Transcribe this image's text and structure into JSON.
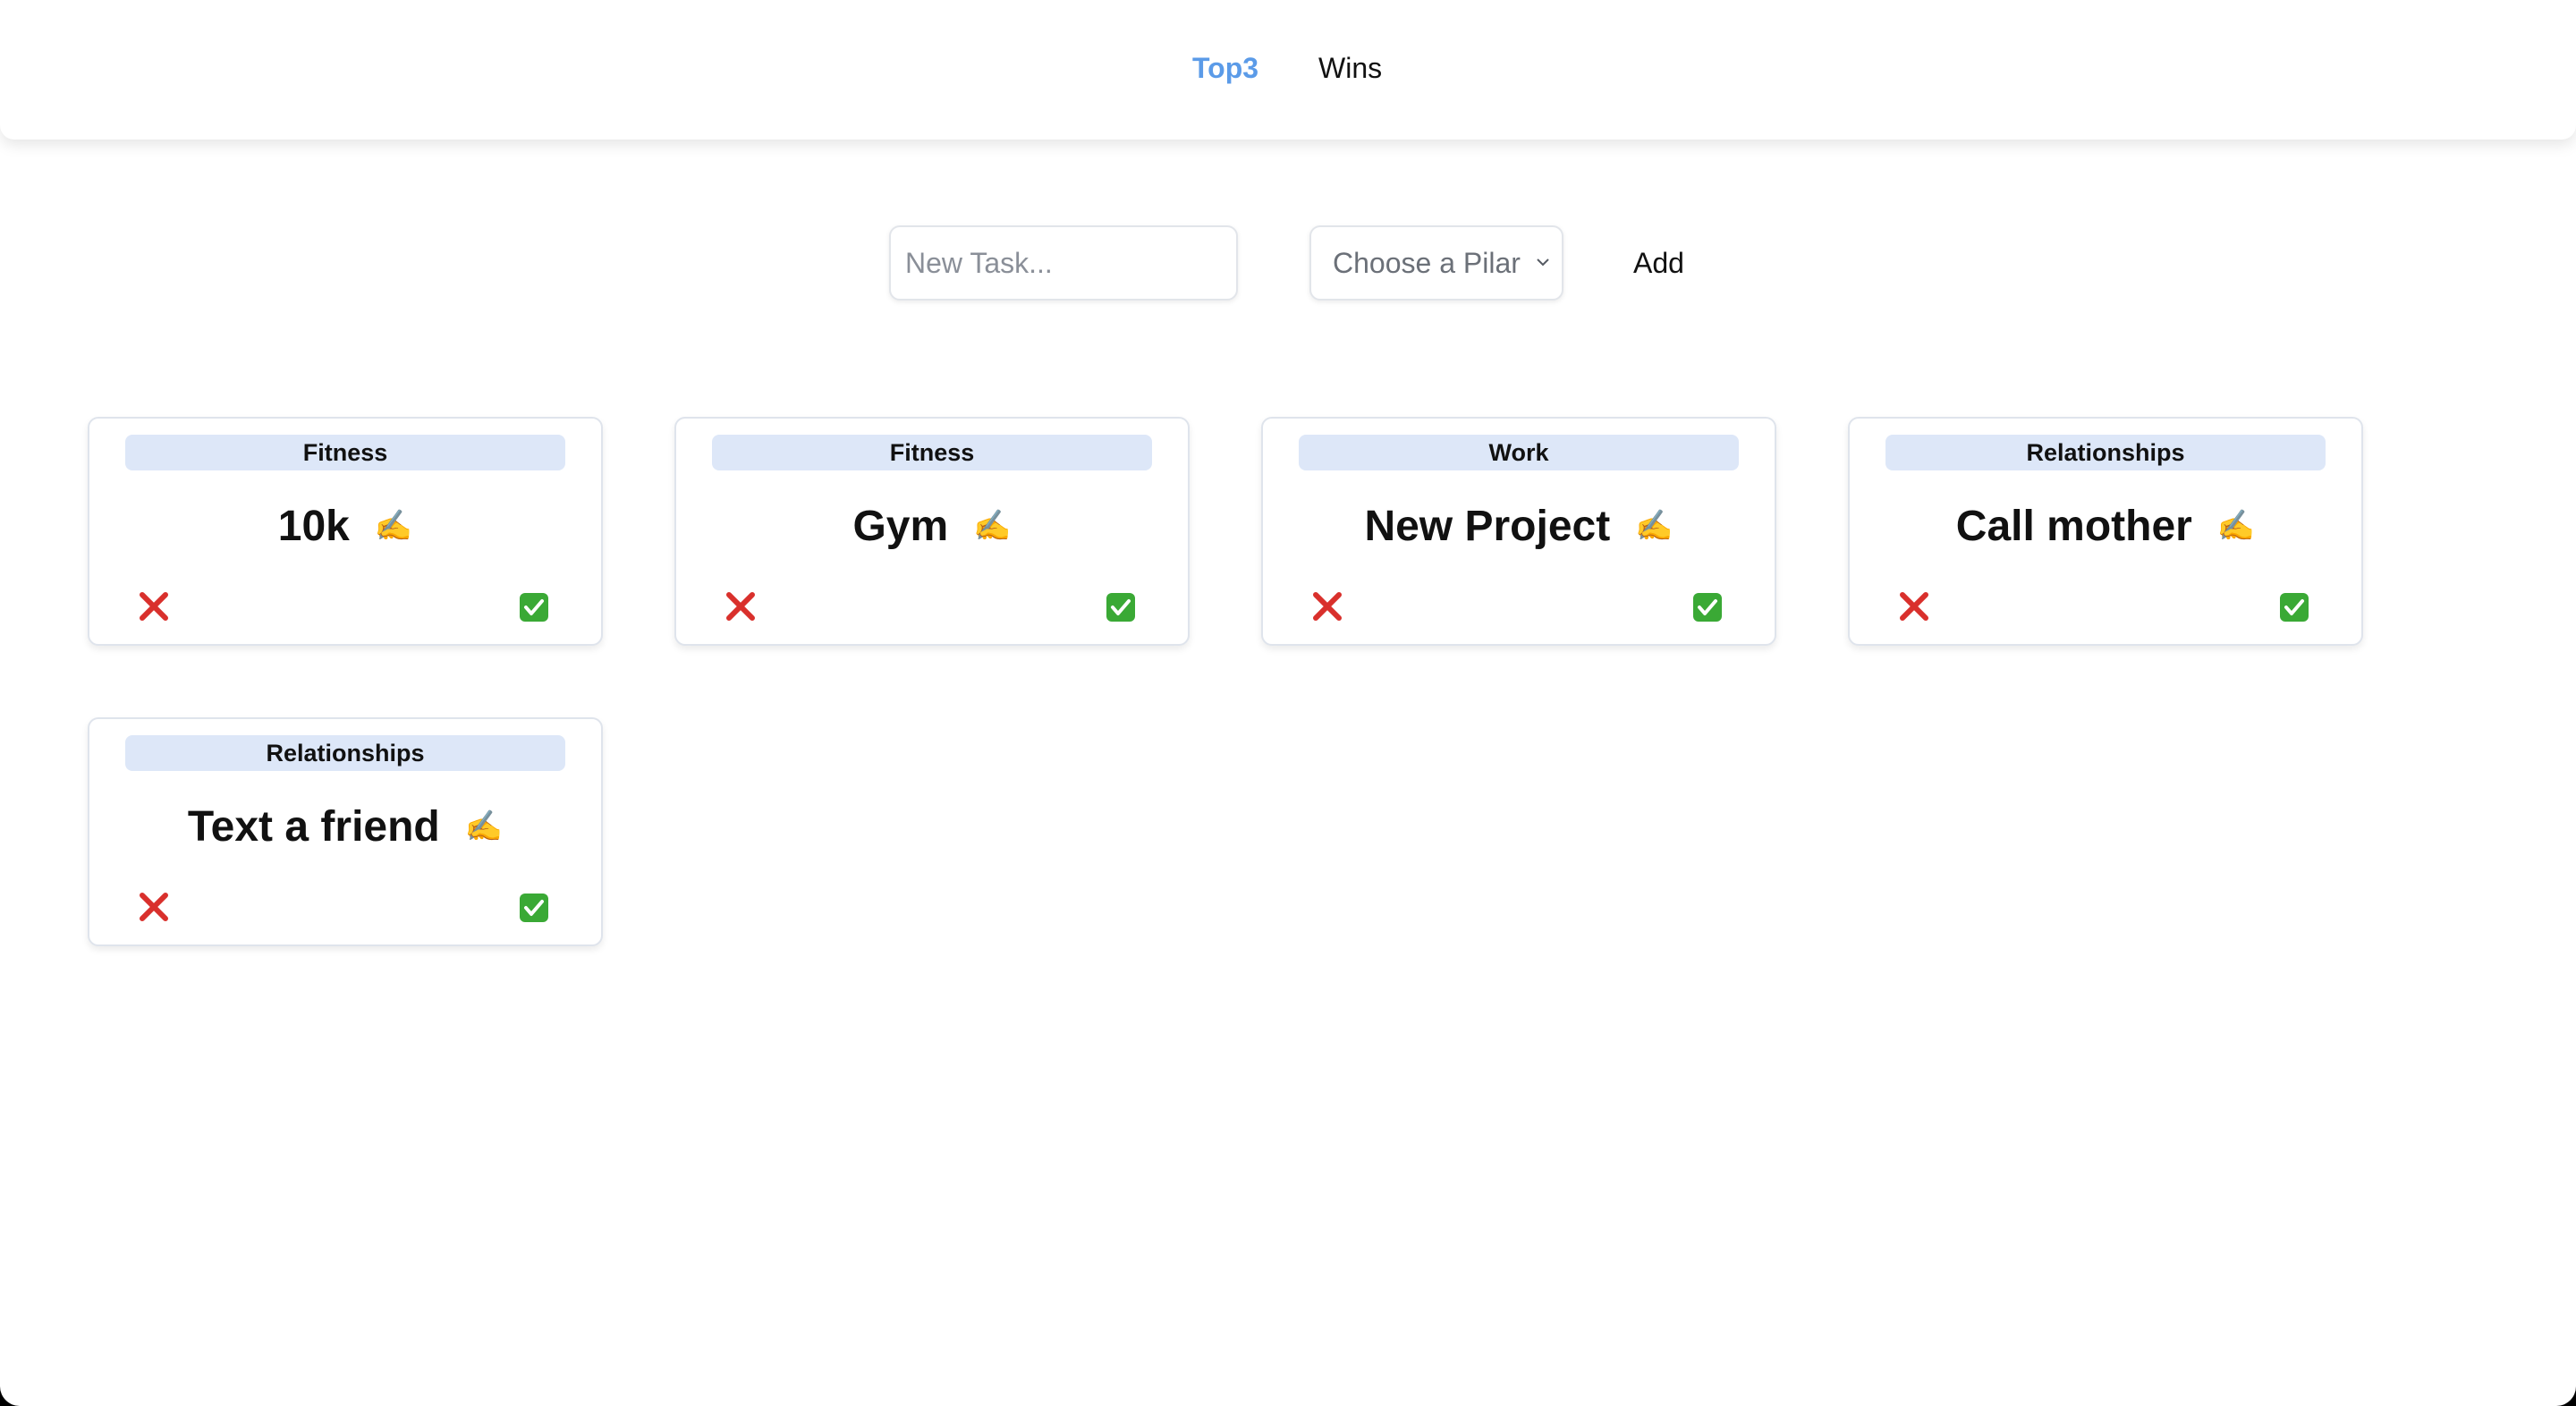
{
  "nav": {
    "top3": "Top3",
    "wins": "Wins",
    "active_color": "#5b9be8"
  },
  "form": {
    "task_placeholder": "New Task...",
    "task_value": "",
    "pilar_selected": "Choose a Pilar",
    "add_label": "Add"
  },
  "tasks": [
    {
      "pilar": "Fitness",
      "title": "10k"
    },
    {
      "pilar": "Fitness",
      "title": "Gym"
    },
    {
      "pilar": "Work",
      "title": "New Project"
    },
    {
      "pilar": "Relationships",
      "title": "Call mother"
    },
    {
      "pilar": "Relationships",
      "title": "Text a friend"
    }
  ],
  "icons": {
    "edit": "writing-hand-icon",
    "delete": "cross-mark-icon",
    "done": "check-mark-icon"
  },
  "colors": {
    "pilar_badge": "#dde7f8",
    "delete": "#d9302c",
    "done": "#3aa935"
  }
}
